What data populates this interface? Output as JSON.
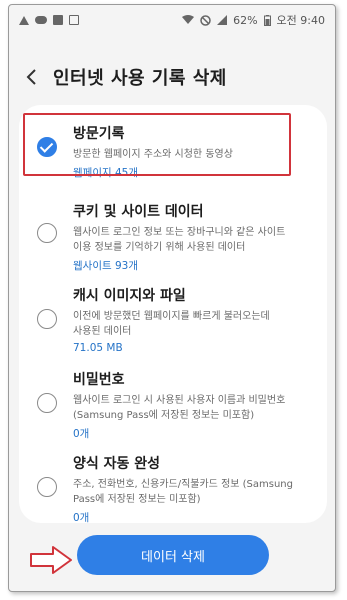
{
  "status_bar": {
    "battery": "62%",
    "time": "오전 9:40",
    "icons": [
      "notification-icon",
      "cloud-icon",
      "image-icon",
      "gallery-icon",
      "wifi-icon",
      "do-not-disturb-icon",
      "signal-icon",
      "battery-icon"
    ]
  },
  "header": {
    "back_icon": "chevron-left-icon",
    "title": "인터넷 사용 기록 삭제"
  },
  "items": [
    {
      "title": "방문기록",
      "desc_lines": [
        "방문한 웹페이지 주소와 시청한 동영상"
      ],
      "meta": "웹페이지 45개",
      "checked": true
    },
    {
      "title": "쿠키 및 사이트 데이터",
      "desc_lines": [
        "웹사이트 로그인 정보 또는 장바구니와 같은 사이트",
        "이용 정보를 기억하기 위해 사용된 데이터"
      ],
      "meta": "웹사이트 93개",
      "checked": false
    },
    {
      "title": "캐시 이미지와 파일",
      "desc_lines": [
        "이전에 방문했던 웹페이지를 빠르게 불러오는데",
        "사용된 데이터"
      ],
      "meta": "71.05 MB",
      "checked": false
    },
    {
      "title": "비밀번호",
      "desc_lines": [
        "웹사이트 로그인 시 사용된 사용자 이름과 비밀번호",
        "(Samsung Pass에 저장된 정보는 미포함)"
      ],
      "meta": "0개",
      "checked": false
    },
    {
      "title": "양식 자동 완성",
      "desc_lines": [
        "주소, 전화번호, 신용카드/직불카드 정보 (Samsung",
        "Pass에 저장된 정보는 미포함)"
      ],
      "meta": "0개",
      "checked": false
    }
  ],
  "colors": {
    "accent": "#2f7fe6",
    "highlight": "#d1343b",
    "link": "#2573c7"
  },
  "footer": {
    "button_label": "데이터 삭제",
    "arrow_icon": "arrow-right-icon"
  }
}
